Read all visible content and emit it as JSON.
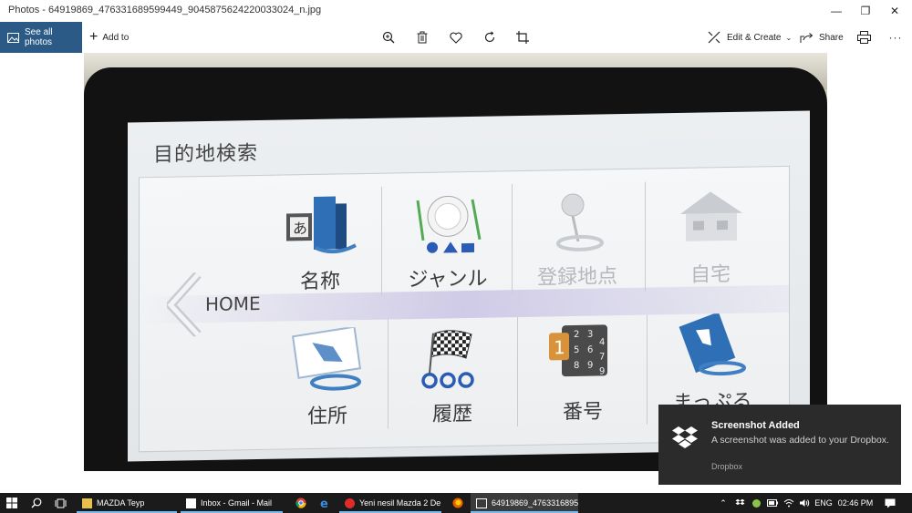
{
  "window": {
    "title": "Photos - 64919869_476331689599449_9045875624220033024_n.jpg",
    "minimize_glyph": "—",
    "maximize_glyph": "❐",
    "close_glyph": "✕"
  },
  "toolbar": {
    "see_all_photos": "See all photos",
    "add_to": "Add to",
    "edit_create": "Edit & Create",
    "share": "Share",
    "more_glyph": "···",
    "icons": [
      "zoom-icon",
      "delete-icon",
      "favorite-icon",
      "rotate-icon",
      "crop-icon",
      "edit-create-icon",
      "share-icon",
      "print-icon"
    ]
  },
  "photo": {
    "screen_title": "目的地検索",
    "home_label": "HOME",
    "tiles": [
      {
        "label": "名称"
      },
      {
        "label": "ジャンル"
      },
      {
        "label": "登録地点"
      },
      {
        "label": "自宅"
      },
      {
        "label": "住所"
      },
      {
        "label": "履歴"
      },
      {
        "label": "番号"
      },
      {
        "label": "まっぷる"
      }
    ],
    "number_pad": [
      "1",
      "2",
      "3",
      "4",
      "5",
      "6",
      "7",
      "8",
      "9"
    ]
  },
  "notification": {
    "title": "Screenshot Added",
    "body": "A screenshot was added to your Dropbox.",
    "source": "Dropbox"
  },
  "taskbar": {
    "items": [
      {
        "label": "MAZDA Teyp"
      },
      {
        "label": "Inbox - Gmail - Mail"
      },
      {
        "label": "Yeni nesil Mazda 2 De..."
      },
      {
        "label": "64919869_4763316895..."
      }
    ],
    "language": "ENG",
    "time": "02:46 PM"
  },
  "colors": {
    "accent": "#2b5a86",
    "taskbar": "#1b1b1b",
    "toast": "#2b2b2b",
    "active_underline": "#76b9ed"
  }
}
